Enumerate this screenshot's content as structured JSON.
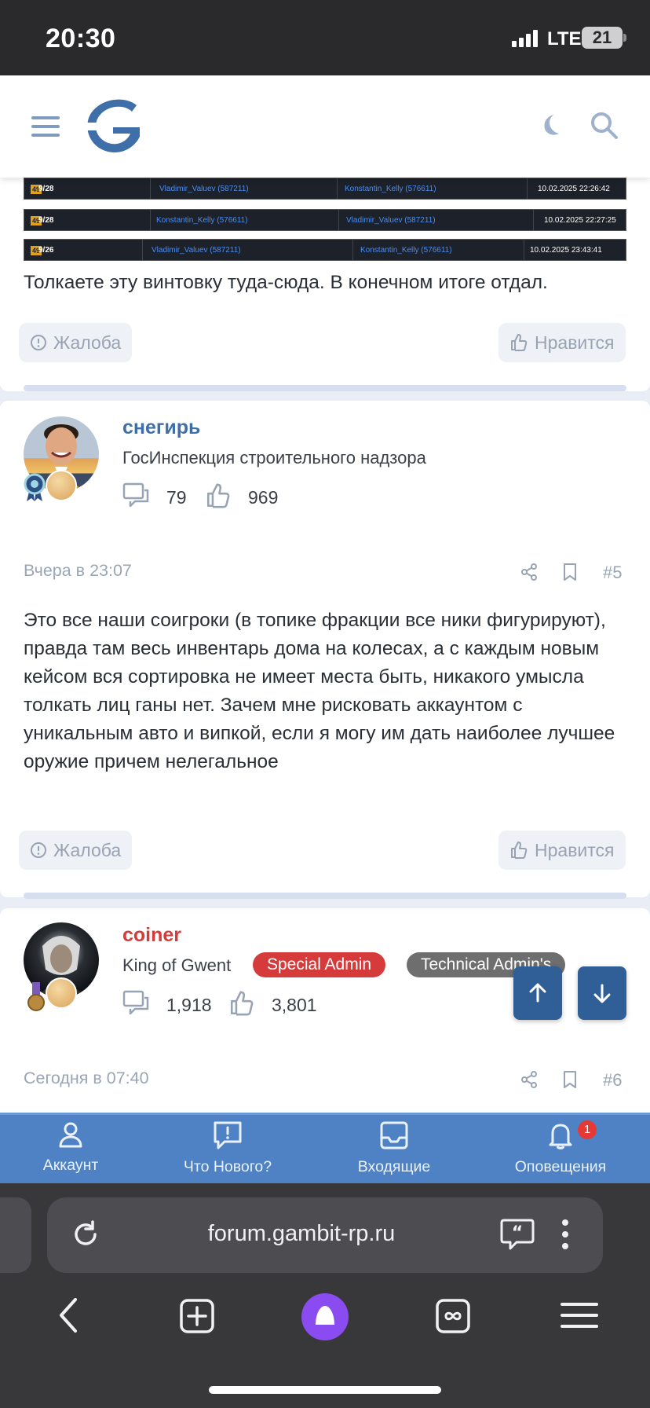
{
  "status_bar": {
    "time": "20:30",
    "network": "LTE",
    "battery": "21"
  },
  "header": {
    "menu_icon": "menu-icon",
    "logo_icon": "gambit-logo-icon",
    "theme_icon": "moon-icon",
    "search_icon": "search-icon"
  },
  "post1": {
    "log_rows": [
      {
        "level": "49",
        "count": "9/28",
        "from": "Vladimir_Valuev (587211)",
        "to": "Konstantin_Kelly (576611)",
        "date": "10.02.2025 22:26:42"
      },
      {
        "level": "49",
        "count": "9/28",
        "from": "Konstantin_Kelly (576611)",
        "to": "Vladimir_Valuev (587211)",
        "date": "10.02.2025 22:27:25"
      },
      {
        "level": "49",
        "count": "9/26",
        "from": "Vladimir_Valuev (587211)",
        "to": "Konstantin_Kelly (576611)",
        "date": "10.02.2025 23:43:41"
      }
    ],
    "text": "Толкаете эту винтовку туда-сюда. В конечном итоге отдал.",
    "report_label": "Жалоба",
    "like_label": "Нравится"
  },
  "post2": {
    "username": "снегирь",
    "user_title": "ГосИнспекция строительного надзора",
    "messages": "79",
    "likes": "969",
    "date": "Вчера в 23:07",
    "number": "#5",
    "text": "Это все наши соигроки (в топике фракции все ники фигурируют), правда там весь инвентарь дома на колесах, а с каждым новым кейсом вся сортировка не имеет места быть, никакого умысла толкать лиц ганы нет. Зачем мне рисковать аккаунтом с уникальным авто и випкой, если я могу им дать наиболее лучшее оружие причем нелегальное",
    "report_label": "Жалоба",
    "like_label": "Нравится"
  },
  "post3": {
    "username": "coiner",
    "user_title": "King of Gwent",
    "badges": [
      "Special Admin",
      "Technical Admin's"
    ],
    "messages": "1,918",
    "likes": "3,801",
    "date": "Сегодня в 07:40",
    "number": "#6"
  },
  "site_nav": {
    "items": [
      {
        "label": "Аккаунт",
        "icon": "user-icon"
      },
      {
        "label": "Что Нового?",
        "icon": "alert-message-icon"
      },
      {
        "label": "Входящие",
        "icon": "inbox-icon"
      },
      {
        "label": "Оповещения",
        "icon": "bell-icon",
        "badge": "1"
      }
    ]
  },
  "browser": {
    "url": "forum.gambit-rp.ru"
  },
  "colors": {
    "accent": "#3f6fa8",
    "nav_bg": "#4e82c4",
    "coiner_red": "#d63b3b",
    "special_admin": "#d63b3b",
    "technical_admin": "#6e6e6e"
  }
}
